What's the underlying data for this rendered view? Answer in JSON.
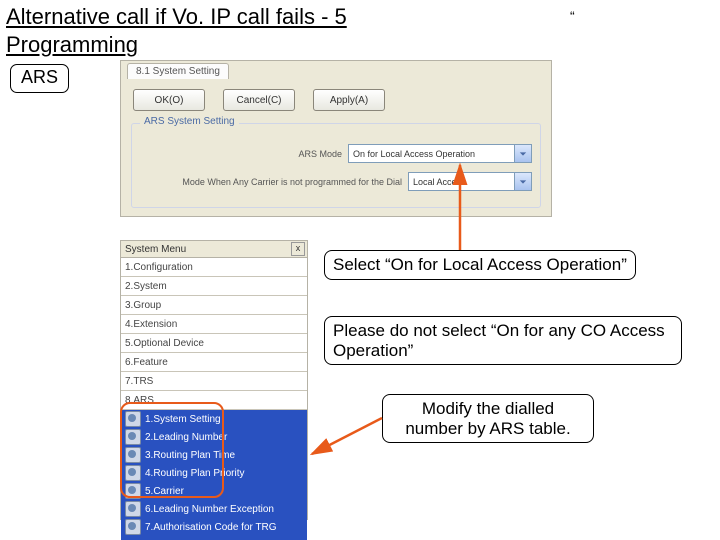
{
  "title_line1": "Alternative call if Vo. IP call fails - 5",
  "title_line2": "Programming",
  "quote_mark": "“",
  "ars_tag": "ARS",
  "panel1": {
    "tab_label": "8.1 System Setting",
    "buttons": {
      "ok": "OK(O)",
      "cancel": "Cancel(C)",
      "apply": "Apply(A)"
    },
    "group_legend": "ARS System Setting",
    "row1_label": "ARS Mode",
    "row1_value": "On for Local Access Operation",
    "row2_label": "Mode When Any Carrier is not programmed for the Dial",
    "row2_value": "Local Access"
  },
  "panel2": {
    "header": "System Menu",
    "close": "x",
    "items": [
      "1.Configuration",
      "2.System",
      "3.Group",
      "4.Extension",
      "5.Optional Device",
      "6.Feature",
      "7.TRS",
      "8.ARS"
    ],
    "sub_items": [
      "1.System Setting",
      "2.Leading Number",
      "3.Routing Plan Time",
      "4.Routing Plan Priority",
      "5.Carrier",
      "6.Leading Number Exception",
      "7.Authorisation Code for TRG"
    ]
  },
  "callouts": {
    "c1": "Select “On for Local Access Operation”",
    "c2": "Please do not select “On for any CO Access Operation”",
    "c3": "Modify the dialled number by ARS table."
  }
}
